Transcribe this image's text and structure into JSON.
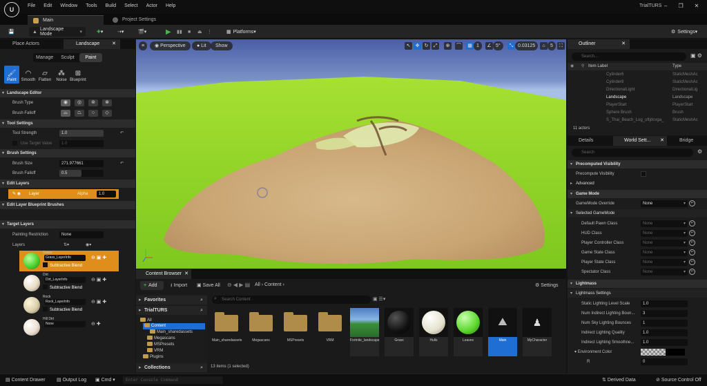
{
  "app": {
    "project": "TrialTURS"
  },
  "menu": [
    "File",
    "Edit",
    "Window",
    "Tools",
    "Build",
    "Select",
    "Actor",
    "Help"
  ],
  "tabs": {
    "main": "Main",
    "project_settings": "Project Settings"
  },
  "toolbar": {
    "mode": "Landscape Mode",
    "platforms": "Platforms",
    "settings": "Settings"
  },
  "left_panel": {
    "tabs": [
      "Place Actors",
      "Landscape"
    ],
    "modes": [
      "Manage",
      "Sculpt",
      "Paint"
    ],
    "active_mode": "Paint",
    "tools": [
      "Paint",
      "Smooth",
      "Flatten",
      "Noise",
      "Blueprint"
    ],
    "sections": {
      "landscape_editor": "Landscape Editor",
      "tool_settings": "Tool Settings",
      "brush_settings": "Brush Settings",
      "edit_layers": "Edit Layers",
      "edit_layer_bp": "Edit Layer Blueprint Brushes",
      "target_layers": "Target Layers"
    },
    "props": {
      "brush_type": "Brush Type",
      "brush_falloff": "Brush Falloff",
      "tool_strength": "Tool Strength",
      "tool_strength_value": "1.0",
      "use_target_value": "Use Target Value",
      "target_value": "1.0",
      "brush_size": "Brush Size",
      "brush_size_value": "271.977661",
      "brush_falloff2": "Brush Falloff",
      "brush_falloff_value": "0.5",
      "layer": "Layer",
      "alpha": "Alpha",
      "alpha_value": "1.0",
      "painting_restriction": "Painting Restriction",
      "painting_restriction_value": "None",
      "layers": "Layers"
    },
    "layer_items": [
      {
        "name": "Grass",
        "info": "Grass_LayerInfo",
        "blend": "Subtractive Blend",
        "color": "#4fd12f"
      },
      {
        "name": "Dirt",
        "info": "Dirt_LayerInfo",
        "blend": "Subtractive Blend",
        "color": "#e8dcc6"
      },
      {
        "name": "Rock",
        "info": "Rock_LayerInfo",
        "blend": "Subtractive Blend",
        "color": "#d9cfae"
      },
      {
        "name": "Hill Dirt",
        "info": "None",
        "blend": "",
        "color": "#ecdfd2"
      }
    ]
  },
  "viewport": {
    "perspective": "Perspective",
    "lit": "Lit",
    "show": "Show",
    "grid_snap": "1",
    "angle_snap": "5°",
    "scale_snap": "0.03125",
    "camera_speed": "5"
  },
  "content_browser": {
    "tab": "Content Browser",
    "add": "Add",
    "import": "Import",
    "save_all": "Save All",
    "path_all": "All",
    "path_content": "Content",
    "settings": "Settings",
    "favorites": "Favorites",
    "project": "TrialTURS",
    "collections": "Collections",
    "tree": [
      "All",
      "Content",
      "Main_sharedassets",
      "Megascans",
      "MSPresets",
      "VRM",
      "Plugins"
    ],
    "search_placeholder": "Search Content",
    "assets": [
      {
        "label": "Main_sharedassets",
        "kind": "folder"
      },
      {
        "label": "Megascans",
        "kind": "folder"
      },
      {
        "label": "MSPresets",
        "kind": "folder"
      },
      {
        "label": "VRM",
        "kind": "folder"
      },
      {
        "label": "Fortnite_landscape",
        "kind": "image"
      },
      {
        "label": "Grass",
        "kind": "material",
        "color": "#111111"
      },
      {
        "label": "Hulls",
        "kind": "material",
        "color": "#e4e2cd"
      },
      {
        "label": "Leaves",
        "kind": "material",
        "color": "#59d62a"
      },
      {
        "label": "Main",
        "kind": "level"
      },
      {
        "label": "MyCharacter",
        "kind": "blueprint"
      }
    ],
    "status": "13 items (1 selected)"
  },
  "outliner": {
    "tab": "Outliner",
    "search_placeholder": "Search...",
    "col_label": "Item Label",
    "col_type": "Type",
    "rows": [
      {
        "name": "Cylinder6",
        "type": "StaticMeshAc",
        "dim": true
      },
      {
        "name": "Cylinder8",
        "type": "StaticMeshAc",
        "dim": true
      },
      {
        "name": "DirectionalLight",
        "type": "DirectionalLig",
        "dim": true
      },
      {
        "name": "Landscape",
        "type": "Landscape",
        "dim": false
      },
      {
        "name": "PlayerStart",
        "type": "PlayerStart",
        "dim": true
      },
      {
        "name": "Sphere Brush",
        "type": "Brush",
        "dim": true
      },
      {
        "name": "S_Thai_Beach_Log_uftjdcvga_",
        "type": "StaticMeshAc",
        "dim": true
      }
    ],
    "count": "11 actors"
  },
  "details": {
    "tabs": [
      "Details",
      "World Sett...",
      "Bridge"
    ],
    "search_placeholder": "Search",
    "sections": {
      "precomputed_visibility": "Precomputed Visibility",
      "advanced": "Advanced",
      "game_mode": "Game Mode",
      "selected_game_mode": "Selected GameMode",
      "lightmass": "Lightmass",
      "lightmass_settings": "Lightmass Settings"
    },
    "precompute_visibility": "Precompute Visibility",
    "gamemode_override": {
      "label": "GameMode Override",
      "value": "None"
    },
    "game_mode_props": [
      {
        "label": "Default Pawn Class",
        "value": "None"
      },
      {
        "label": "HUD Class",
        "value": "None"
      },
      {
        "label": "Player Controller Class",
        "value": "None"
      },
      {
        "label": "Game State Class",
        "value": "None"
      },
      {
        "label": "Player State Class",
        "value": "None"
      },
      {
        "label": "Spectator Class",
        "value": "None"
      }
    ],
    "lightmass_props": [
      {
        "label": "Static Lighting Level Scale",
        "value": "1.0"
      },
      {
        "label": "Num Indirect Lighting Boun...",
        "value": "3"
      },
      {
        "label": "Num Sky Lighting Bounces",
        "value": "1"
      },
      {
        "label": "Indirect Lighting Quality",
        "value": "1.0"
      },
      {
        "label": "Indirect Lighting Smoothne...",
        "value": "1.0"
      }
    ],
    "environment_color": "Environment Color",
    "env_r": {
      "label": "R",
      "value": "0"
    }
  },
  "statusbar": {
    "content_drawer": "Content Drawer",
    "output_log": "Output Log",
    "cmd": "Cmd",
    "console_placeholder": "Enter Console Command",
    "derived_data": "Derived Data",
    "source_control": "Source Control Off"
  }
}
